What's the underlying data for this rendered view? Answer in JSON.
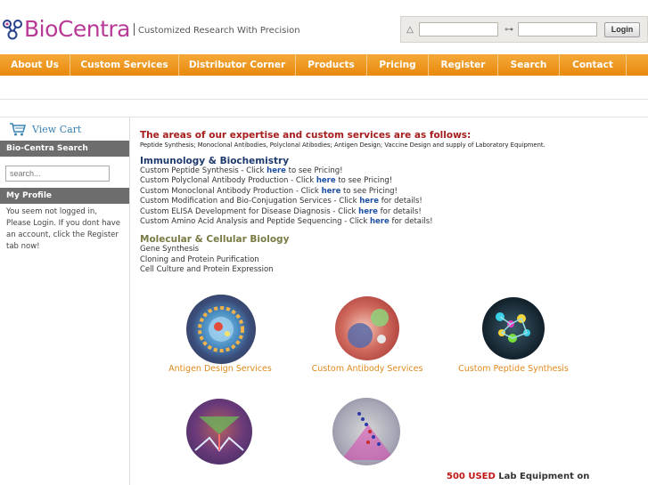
{
  "logo": {
    "text": "BioCentra",
    "tagline": "Customized Research With Precision"
  },
  "login": {
    "user_icon": "warning-triangle-icon",
    "key_icon": "key-icon",
    "button": "Login"
  },
  "nav": [
    {
      "label": "About Us"
    },
    {
      "label": "Custom Services"
    },
    {
      "label": "Distributor Corner"
    },
    {
      "label": "Products"
    },
    {
      "label": "Pricing"
    },
    {
      "label": "Register"
    },
    {
      "label": "Search"
    },
    {
      "label": "Contact"
    }
  ],
  "sidebar": {
    "cart_label": "View Cart",
    "search_heading": "Bio-Centra Search",
    "search_placeholder": "search...",
    "profile_heading": "My Profile",
    "profile_text": "You seem not logged in, Please Login. If you dont have an account, click the Register tab now!"
  },
  "main": {
    "headline": "The areas of our expertise and custom services are as follows:",
    "subline": "Peptide Synthesis; Monoclonal Antibodies, Polyclonal Atibodies; Antigen Design; Vaccine Design and supply of Laboratory Equipment.",
    "immuno_title": "Immunology & Biochemistry",
    "immuno_lines": [
      {
        "pre": "Custom Peptide Synthesis - Click ",
        "link": "here",
        "post": " to see Pricing!"
      },
      {
        "pre": "Custom Polyclonal Antibody Production - Click ",
        "link": "here",
        "post": " to see Pricing!"
      },
      {
        "pre": "Custom Monoclonal Antibody Production - Click ",
        "link": "here",
        "post": " to see Pricing!"
      },
      {
        "pre": "Custom Modification and Bio-Conjugation Services - Click ",
        "link": "here",
        "post": " for details!"
      },
      {
        "pre": "Custom ELISA Development for Disease Diagnosis - Click ",
        "link": "here",
        "post": " for details!"
      },
      {
        "pre": "Custom Amino Acid Analysis and Peptide Sequencing - Click ",
        "link": "here",
        "post": " for details!"
      }
    ],
    "molbio_title": "Molecular & Cellular Biology",
    "molbio_lines": [
      "Gene Synthesis",
      "Cloning and Protein Purification",
      "Cell Culture and Protein Expression"
    ]
  },
  "services": {
    "antigen": "Antigen Design Services",
    "antibody": "Custom Antibody Services",
    "peptide": "Custom Peptide Synthesis"
  },
  "promo": {
    "count": "500 USED",
    "rest": " Lab Equipment on"
  },
  "colors": {
    "nav_orange": "#ee9520",
    "headline_red": "#a61c1c",
    "link_blue": "#1d4fa3",
    "label_orange": "#e08a1e"
  }
}
